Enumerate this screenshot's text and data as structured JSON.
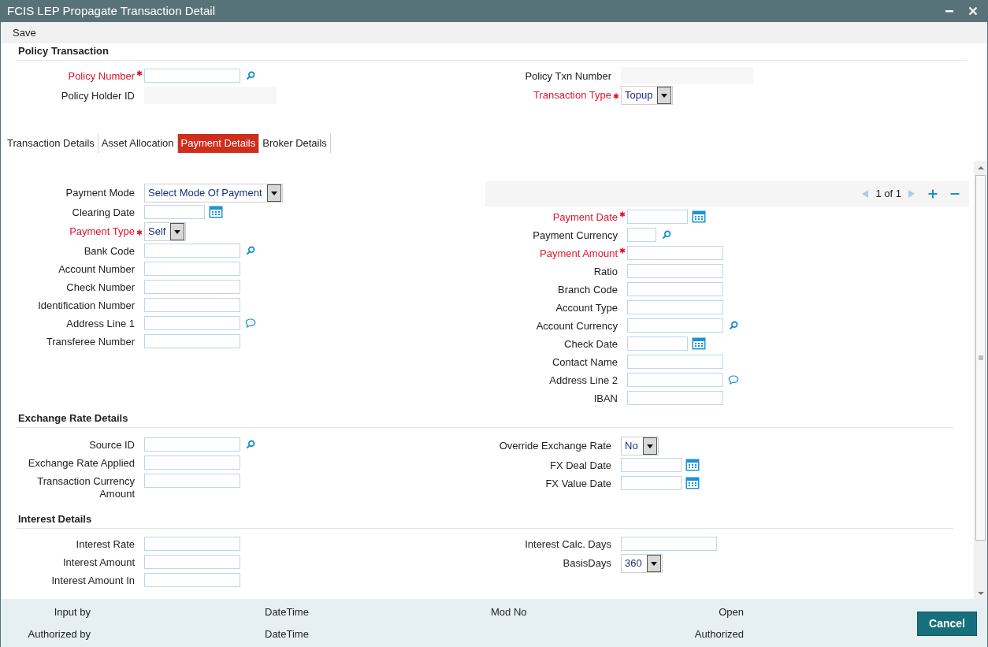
{
  "window": {
    "title": "FCIS LEP Propagate Transaction Detail"
  },
  "toolbar": [
    {
      "label": "Save"
    }
  ],
  "policy_transaction": {
    "title": "Policy Transaction",
    "left": [
      {
        "label": "Policy Number",
        "kind": "lookup",
        "required": true
      },
      {
        "label": "Policy Holder ID",
        "kind": "readonly",
        "required": false
      }
    ],
    "right": [
      {
        "label": "Policy Txn Number",
        "kind": "readonly",
        "required": false
      },
      {
        "label": "Transaction Type",
        "kind": "select",
        "required": true,
        "value": "Topup"
      }
    ]
  },
  "tabs": [
    {
      "label": "Transaction Details",
      "selected": false
    },
    {
      "label": "Asset Allocation",
      "selected": false
    },
    {
      "label": "Payment Details",
      "selected": true
    },
    {
      "label": "Broker Details",
      "selected": false
    }
  ],
  "payment_details": {
    "pager": {
      "text": "1 of 1"
    },
    "left": [
      {
        "label": "Payment Mode",
        "kind": "select",
        "required": false,
        "value": "Select Mode Of Payment"
      },
      {
        "label": "Clearing Date",
        "kind": "date",
        "required": false
      },
      {
        "label": "Payment Type",
        "kind": "select",
        "required": true,
        "value": "Self"
      },
      {
        "label": "Bank Code",
        "kind": "lookup",
        "required": false
      },
      {
        "label": "Account Number",
        "kind": "text",
        "required": false
      },
      {
        "label": "Check Number",
        "kind": "text",
        "required": false
      },
      {
        "label": "Identification Number",
        "kind": "text",
        "required": false
      },
      {
        "label": "Address Line 1",
        "kind": "comment",
        "required": false
      },
      {
        "label": "Transferee Number",
        "kind": "text",
        "required": false
      }
    ],
    "right": [
      {
        "label": "Payment Date",
        "kind": "date",
        "required": true
      },
      {
        "label": "Payment Currency",
        "kind": "short_lookup",
        "required": false
      },
      {
        "label": "Payment Amount",
        "kind": "text",
        "required": true
      },
      {
        "label": "Ratio",
        "kind": "text",
        "required": false
      },
      {
        "label": "Branch Code",
        "kind": "text",
        "required": false
      },
      {
        "label": "Account Type",
        "kind": "text",
        "required": false
      },
      {
        "label": "Account Currency",
        "kind": "lookup",
        "required": false
      },
      {
        "label": "Check Date",
        "kind": "date",
        "required": false
      },
      {
        "label": "Contact Name",
        "kind": "text",
        "required": false
      },
      {
        "label": "Address Line 2",
        "kind": "comment",
        "required": false
      },
      {
        "label": "IBAN",
        "kind": "text",
        "required": false
      }
    ]
  },
  "exchange_rate_details": {
    "title": "Exchange Rate Details",
    "left": [
      {
        "label": "Source ID",
        "kind": "lookup",
        "required": false
      },
      {
        "label": "Exchange Rate Applied",
        "kind": "text",
        "required": false
      },
      {
        "label": "Transaction Currency Amount",
        "kind": "text",
        "required": false
      }
    ],
    "right": [
      {
        "label": "Override Exchange Rate",
        "kind": "select",
        "required": false,
        "value": "No"
      },
      {
        "label": "FX Deal Date",
        "kind": "date",
        "required": false
      },
      {
        "label": "FX Value Date",
        "kind": "date",
        "required": false
      }
    ]
  },
  "interest_details": {
    "title": "Interest Details",
    "left": [
      {
        "label": "Interest Rate",
        "kind": "text",
        "required": false
      },
      {
        "label": "Interest Amount",
        "kind": "text",
        "required": false
      },
      {
        "label": "Interest Amount In",
        "kind": "text",
        "required": false
      }
    ],
    "right": [
      {
        "label": "Interest Calc. Days",
        "kind": "text",
        "required": false
      },
      {
        "label": "BasisDays",
        "kind": "select",
        "required": false,
        "value": "360"
      }
    ]
  },
  "footer": {
    "rows": [
      [
        "Input by",
        "DateTime",
        "Mod No",
        "Open"
      ],
      [
        "Authorized by",
        "DateTime",
        "",
        "Authorized"
      ]
    ],
    "cancel": "Cancel"
  }
}
